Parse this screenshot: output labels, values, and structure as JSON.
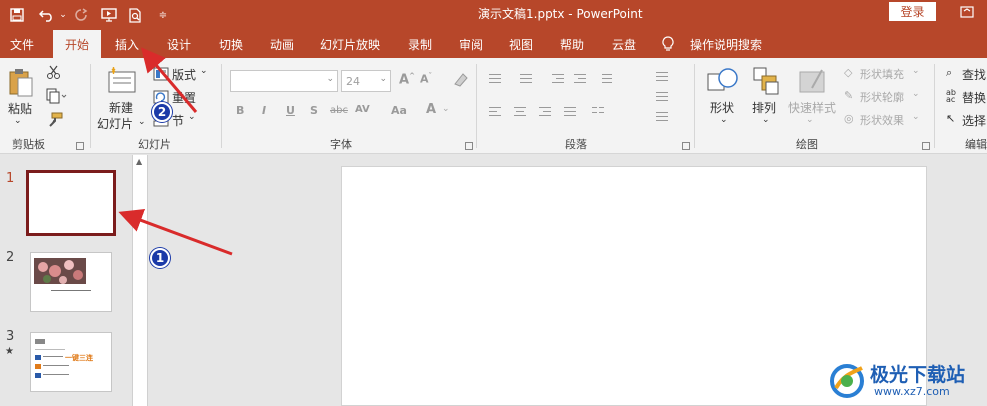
{
  "window": {
    "title": "演示文稿1.pptx  -  PowerPoint",
    "login_label": "登录"
  },
  "tabs": [
    {
      "label": "文件"
    },
    {
      "label": "开始"
    },
    {
      "label": "插入"
    },
    {
      "label": "设计"
    },
    {
      "label": "切换"
    },
    {
      "label": "动画"
    },
    {
      "label": "幻灯片放映"
    },
    {
      "label": "录制"
    },
    {
      "label": "审阅"
    },
    {
      "label": "视图"
    },
    {
      "label": "帮助"
    },
    {
      "label": "云盘"
    },
    {
      "label": "操作说明搜索"
    }
  ],
  "ribbon": {
    "clipboard": {
      "paste": "粘贴",
      "group": "剪贴板"
    },
    "slides": {
      "new_slide": "新建",
      "new_slide2": "幻灯片",
      "layout": "版式",
      "reset": "重置",
      "section": "节",
      "group": "幻灯片"
    },
    "font": {
      "font_size": "24",
      "group": "字体",
      "b": "B",
      "i": "I",
      "u": "U",
      "s": "S",
      "abc": "abc",
      "av": "AV",
      "aa": "Aa",
      "a": "A"
    },
    "paragraph": {
      "group": "段落"
    },
    "drawing": {
      "shapes": "形状",
      "arrange": "排列",
      "quick_styles": "快速样式",
      "fill": "形状填充",
      "outline": "形状轮廓",
      "effects": "形状效果",
      "group": "绘图"
    },
    "editing": {
      "find": "查找",
      "replace": "替换",
      "select": "选择",
      "group": "编辑"
    }
  },
  "slides": [
    {
      "number": "1"
    },
    {
      "number": "2"
    },
    {
      "number": "3"
    }
  ],
  "thumb3": {
    "headline": "一键三连"
  },
  "annotations": [
    {
      "label": "1"
    },
    {
      "label": "2"
    }
  ],
  "watermark": {
    "brand": "极光下载站",
    "url": "www.xz7.com"
  },
  "colors": {
    "accent": "#b7472a",
    "selected_border": "#7b1c1c",
    "badge": "#1b3aa8",
    "arrow": "#d92b2b"
  }
}
